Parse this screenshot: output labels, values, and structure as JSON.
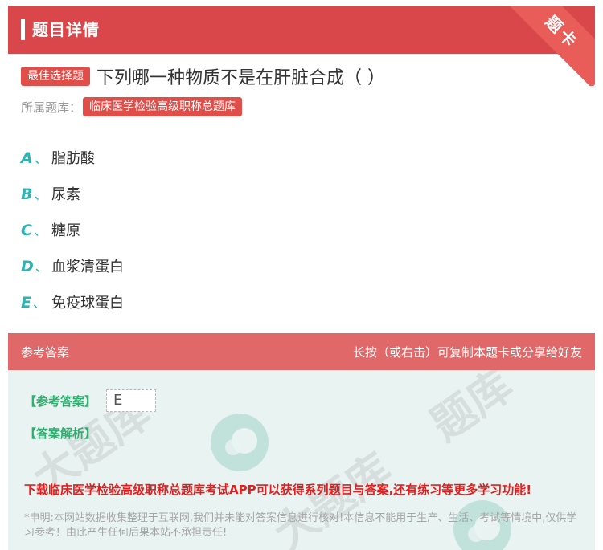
{
  "header": {
    "title": "题目详情",
    "ribbon": "题卡"
  },
  "question": {
    "tag": "最佳选择题",
    "text": "下列哪一种物质不是在肝脏合成（ ）"
  },
  "bank": {
    "label": "所属题库：",
    "name": "临床医学检验高级职称总题库"
  },
  "options": [
    {
      "letter": "A",
      "sep": "、",
      "text": "脂肪酸"
    },
    {
      "letter": "B",
      "sep": "、",
      "text": "尿素"
    },
    {
      "letter": "C",
      "sep": "、",
      "text": "糖原"
    },
    {
      "letter": "D",
      "sep": "、",
      "text": "血浆清蛋白"
    },
    {
      "letter": "E",
      "sep": "、",
      "text": "免疫球蛋白"
    }
  ],
  "answer_section": {
    "title": "参考答案",
    "hint": "长按（或右击）可复制本题卡或分享给好友",
    "answer_label": "【参考答案】",
    "answer_value": "E",
    "analysis_label": "【答案解析】",
    "promo": "下载临床医学检验高级职称总题库考试APP可以获得系列题目与答案,还有练习等更多学习功能!",
    "disclaimer": "*申明:本网站数据收集整理于互联网,我们并未能对答案信息进行核对!本信息不能用于生产、生活、考试等情境中,仅供学习参考！由此产生任何后果本站不承担责任!"
  },
  "colors": {
    "header": "#d9474a",
    "answer_header": "#e06868",
    "option_letter": "#2eb3b3",
    "answer_label": "#2fae6f",
    "promo": "#e02020"
  }
}
